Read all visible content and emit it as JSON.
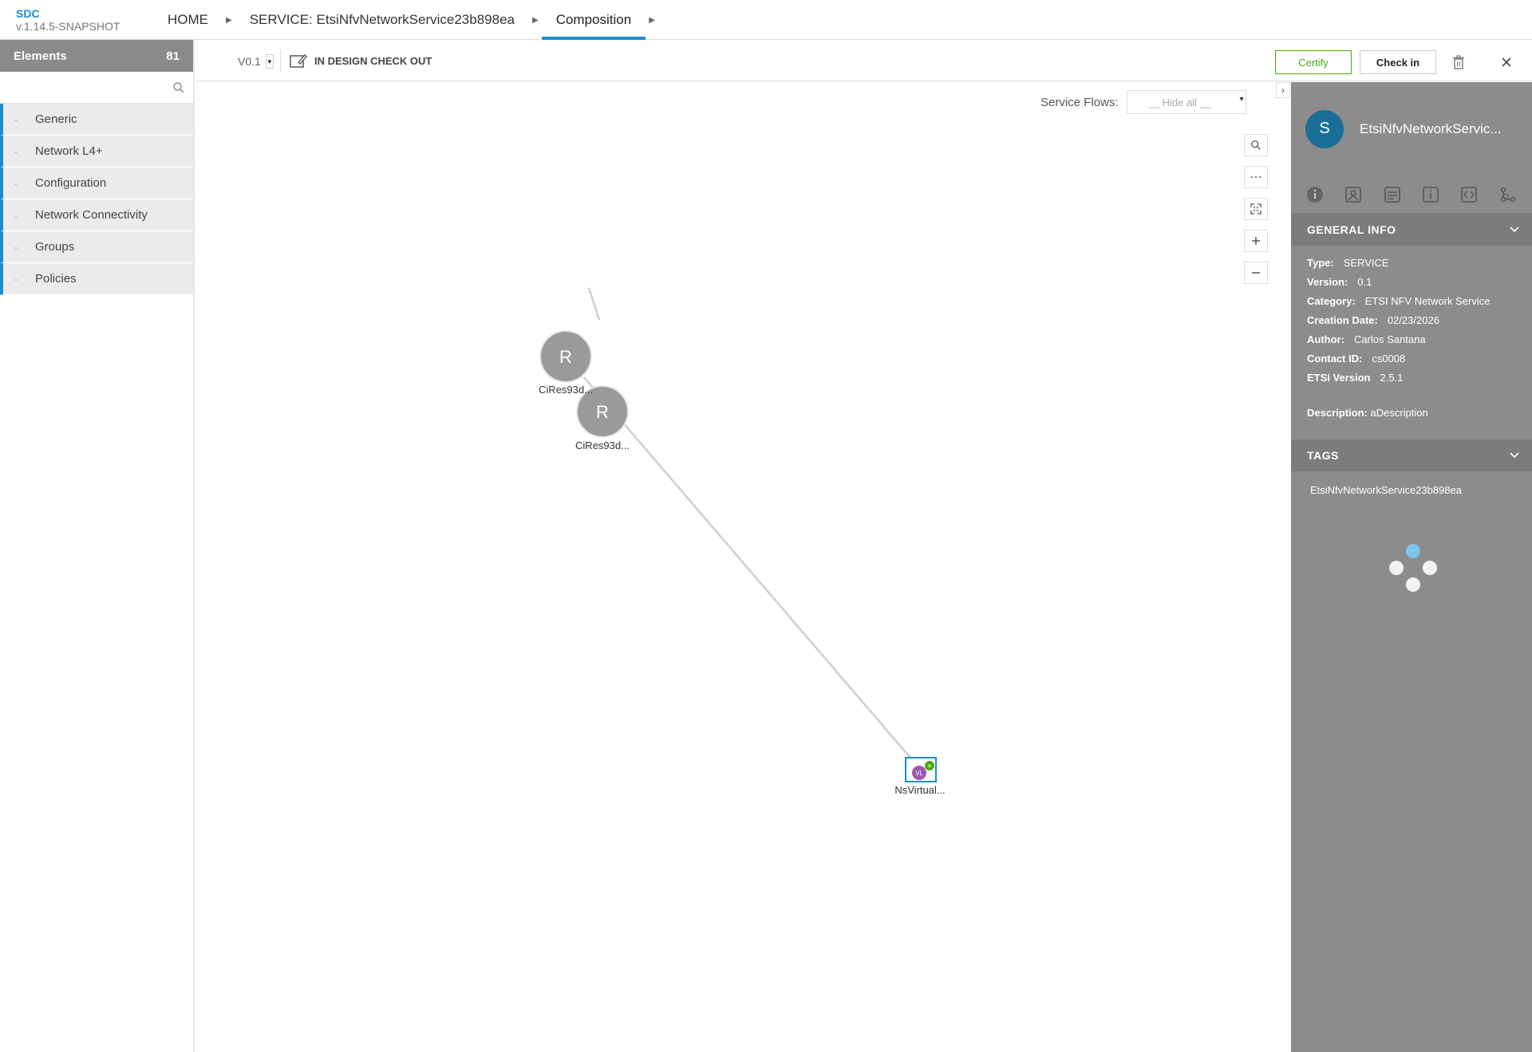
{
  "app": {
    "name": "SDC",
    "version": "v.1.14.5-SNAPSHOT"
  },
  "breadcrumb": {
    "home": "HOME",
    "service": "SERVICE: EtsiNfvNetworkService23b898ea",
    "current": "Composition"
  },
  "palette": {
    "title": "Elements",
    "count": "81",
    "search_placeholder": "",
    "dash": "-",
    "groups": [
      {
        "label": "Generic"
      },
      {
        "label": "Network L4+"
      },
      {
        "label": "Configuration"
      },
      {
        "label": "Network Connectivity"
      },
      {
        "label": "Groups"
      },
      {
        "label": "Policies"
      }
    ]
  },
  "toolbar": {
    "version": "V0.1",
    "status": "IN DESIGN CHECK OUT",
    "certify_label": "Certify",
    "checkin_label": "Check in"
  },
  "canvas": {
    "service_flows_label": "Service Flows:",
    "service_flows_value": "__ Hide all __",
    "nodes": [
      {
        "label": "CiRes93d...",
        "letter": "R"
      },
      {
        "label": "CiRes93d...",
        "letter": "R"
      },
      {
        "label": "NsVirtual...",
        "letter": "VL"
      }
    ]
  },
  "right_panel": {
    "avatar_letter": "S",
    "title": "EtsiNfvNetworkServic...",
    "general_info_title": "GENERAL INFO",
    "fields": [
      {
        "key": "Type:",
        "value": "SERVICE"
      },
      {
        "key": "Version:",
        "value": "0.1"
      },
      {
        "key": "Category:",
        "value": "ETSI NFV Network Service"
      },
      {
        "key": "Creation Date:",
        "value": "02/23/2026"
      },
      {
        "key": "Author:",
        "value": "Carlos Santana"
      },
      {
        "key": "Contact ID:",
        "value": "cs0008"
      },
      {
        "key": "ETSI Version",
        "value": "2.5.1"
      }
    ],
    "description_key": "Description:",
    "description_value": "aDescription",
    "tags_title": "TAGS",
    "tags": [
      "EtsiNfvNetworkService23b898ea"
    ]
  },
  "colors": {
    "accent": "#1a8fcf",
    "certify": "#4ca90c",
    "panel": "#8c8c8c",
    "node": "#9a9a9a"
  }
}
